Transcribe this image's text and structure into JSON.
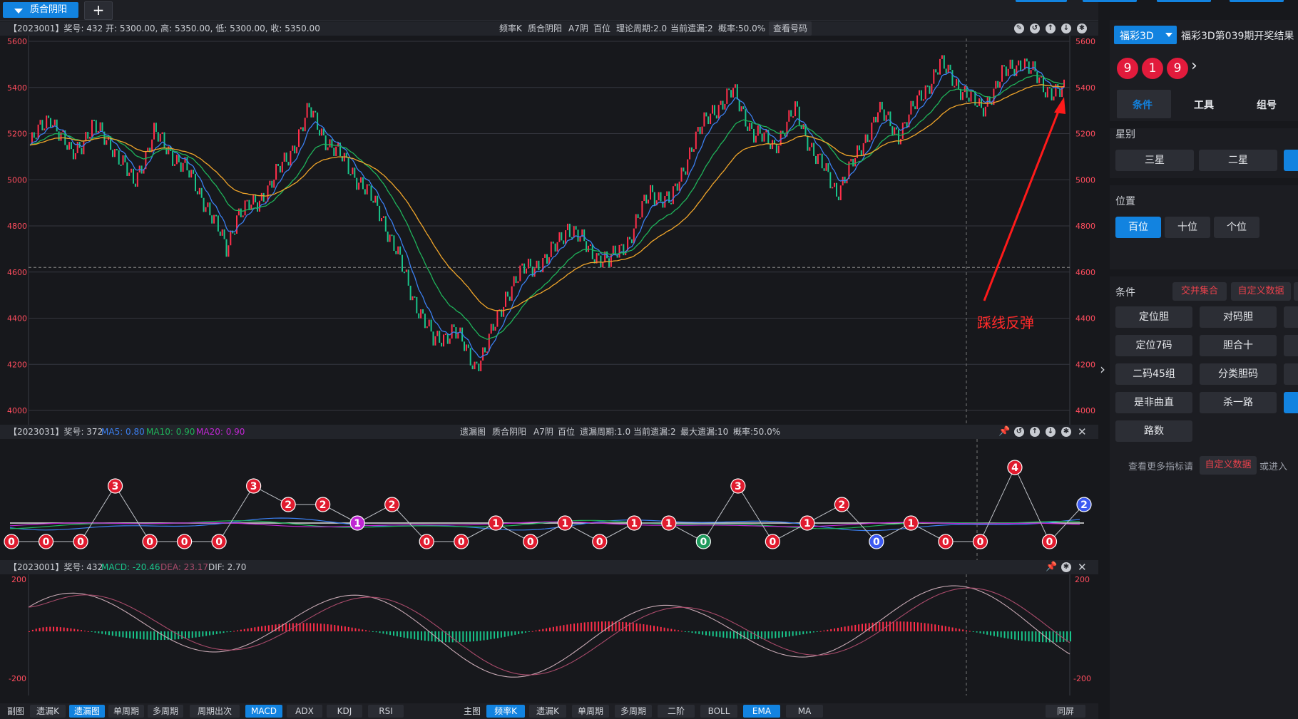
{
  "top_tabs": {
    "active_label": "质合阴阳",
    "add_label": "+"
  },
  "panel1": {
    "info": "【2023001】奖号: 432  开: 5300.00, 高: 5350.00, 低: 5300.00, 收: 5350.00",
    "center_items": [
      "频率K",
      "质合阴阳",
      "A7阴",
      "百位",
      "理论周期:2.0",
      "当前遗漏:2",
      "概率:50.0%"
    ],
    "view_button": "查看号码",
    "annotation": "踩线反弹",
    "y_ticks": [
      5600,
      5400,
      5200,
      5000,
      4800,
      4600,
      4400,
      4200,
      4000
    ],
    "ref_line": 4620,
    "colors": {
      "up": "#ff2f4a",
      "down": "#19c48a",
      "fast": "#3b7ff0",
      "mid": "#1fb35a",
      "slow": "#f0a52a",
      "arrow": "#ff1a1a"
    }
  },
  "panel2": {
    "info_prefix": "【2023031】奖号: 372",
    "ma5": "MA5: 0.80",
    "ma10": "MA10: 0.90",
    "ma20": "MA20: 0.90",
    "center_items": [
      "遗漏图",
      "质合阴阳",
      "A7阴",
      "百位",
      "遗漏周期:1.0",
      "当前遗漏:2",
      "最大遗漏:10",
      "概率:50.0%"
    ],
    "omission_values": [
      0,
      0,
      0,
      3,
      0,
      0,
      0,
      3,
      2,
      2,
      1,
      2,
      0,
      0,
      1,
      0,
      1,
      0,
      1,
      1,
      0,
      3,
      0,
      1,
      2,
      0,
      1,
      0,
      0,
      4,
      0,
      2
    ]
  },
  "panel3": {
    "info_prefix": "【2023001】奖号: 432",
    "macd": "MACD: -20.46",
    "dea": "DEA: 23.17",
    "dif": "DIF: 2.70",
    "y_ticks": [
      200,
      -200
    ]
  },
  "bottom_toolbar": {
    "left_label": "副图",
    "left_buttons": [
      "遗漏K",
      "遗漏图",
      "单周期",
      "多周期",
      "周期出次",
      "MACD",
      "ADX",
      "KDJ",
      "RSI"
    ],
    "left_active": [
      "遗漏图",
      "MACD"
    ],
    "main_label": "主图",
    "main_buttons": [
      "频率K",
      "遗漏K",
      "单周期",
      "多周期",
      "二阶",
      "BOLL",
      "EMA",
      "MA"
    ],
    "main_active": [
      "频率K",
      "EMA"
    ],
    "sync_button": "同屏"
  },
  "sidebar": {
    "lottery_select": "福彩3D",
    "draw_title": "福彩3D第039期开奖结果",
    "balls": [
      "9",
      "1",
      "9"
    ],
    "tabs": [
      "条件",
      "工具",
      "组号"
    ],
    "active_tab": "条件",
    "star_label": "星别",
    "star_buttons": [
      "三星",
      "二星"
    ],
    "position_label": "位置",
    "position_buttons": [
      "百位",
      "十位",
      "个位"
    ],
    "active_position": "百位",
    "condition_label": "条件",
    "condition_links": [
      "交并集合",
      "自定义数据"
    ],
    "condition_buttons": [
      "定位胆",
      "对码胆",
      "定位7码",
      "胆合十",
      "二码45组",
      "分类胆码",
      "是非曲直",
      "杀一路",
      "路数"
    ],
    "more_hint": "查看更多指标请",
    "more_link": "自定义数据",
    "more_suffix": "或进入"
  }
}
